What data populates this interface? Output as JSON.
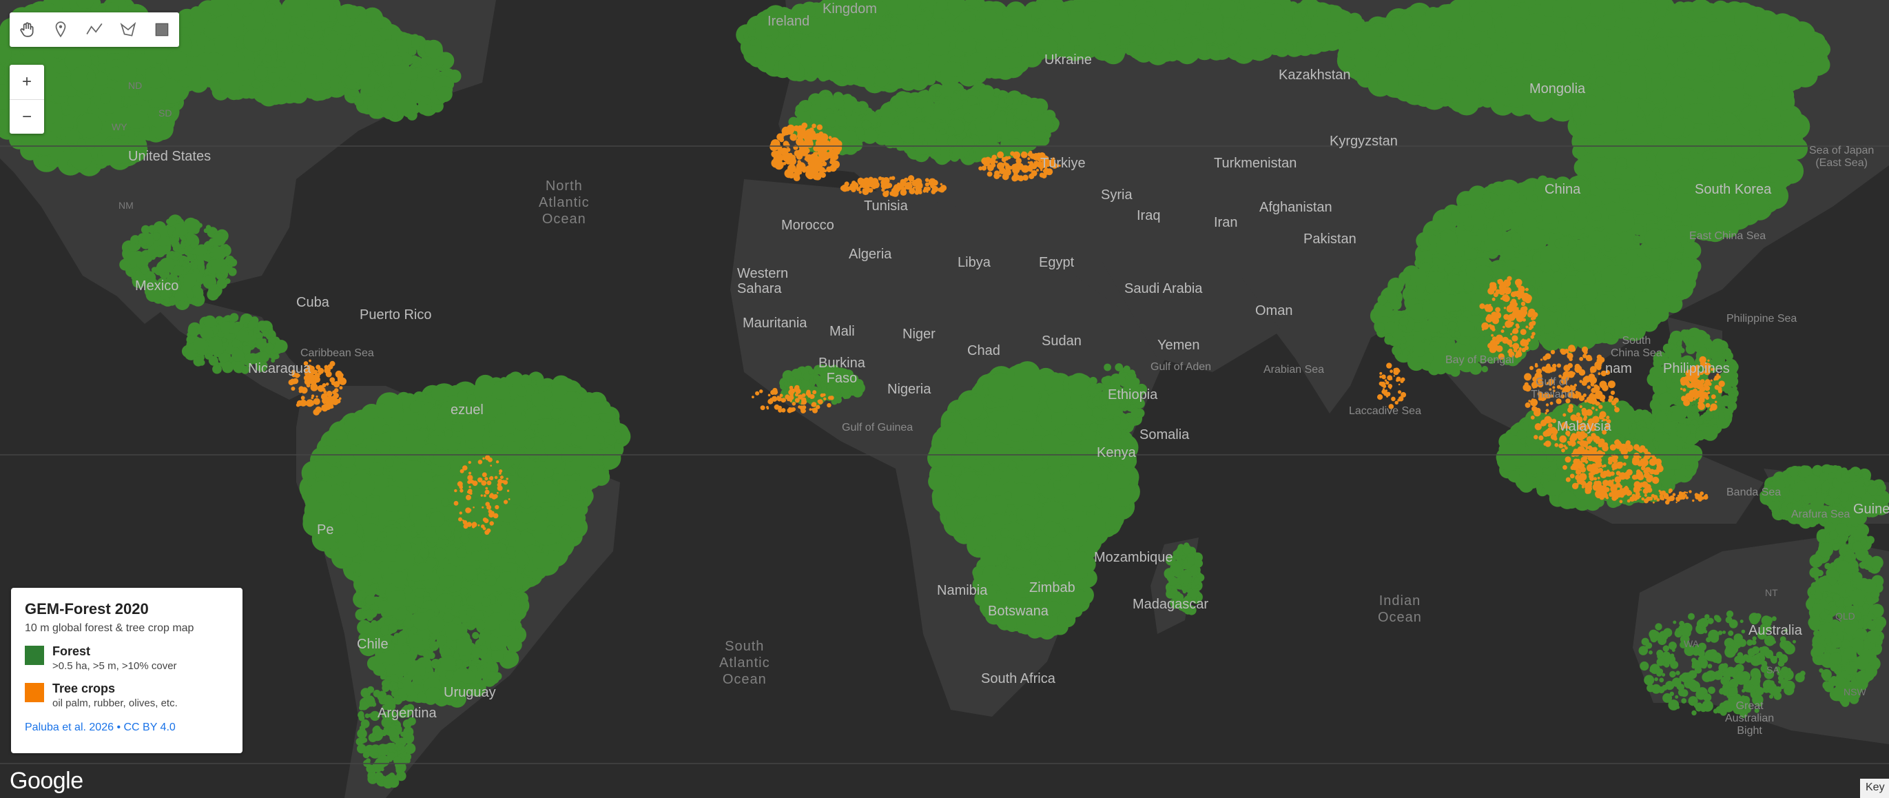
{
  "toolbar": {
    "tools": [
      {
        "name": "hand-pan-icon"
      },
      {
        "name": "marker-pin-icon"
      },
      {
        "name": "polyline-icon"
      },
      {
        "name": "polygon-icon"
      },
      {
        "name": "rectangle-icon"
      }
    ]
  },
  "zoom": {
    "in": "+",
    "out": "−"
  },
  "legend": {
    "title": "GEM-Forest 2020",
    "subtitle": "10 m global forest & tree crop map",
    "items": [
      {
        "label": "Forest",
        "desc": ">0.5 ha, >5 m, >10% cover",
        "color": "#2e7d32"
      },
      {
        "label": "Tree crops",
        "desc": "oil palm, rubber, olives, etc.",
        "color": "#f57c00"
      }
    ],
    "credit": "Paluba et al. 2026 • CC BY 4.0"
  },
  "branding": {
    "logo": "Google",
    "keyboard": "Key"
  },
  "colors": {
    "forest": "#3f8f2f",
    "treecrops": "#f08c1a",
    "land": "#3a3a3a",
    "water": "#2b2b2b"
  },
  "labels": {
    "ireland": "Ireland",
    "kingdom": "Kingdom",
    "kazakhstan": "Kazakhstan",
    "mongolia": "Mongolia",
    "kyrgyzstan": "Kyrgyzstan",
    "turkmenistan": "Turkmenistan",
    "turkiye": "Türkiye",
    "ukraine": "Ukraine",
    "china": "China",
    "south_korea": "South Korea",
    "afghanistan": "Afghanistan",
    "iran": "Iran",
    "iraq": "Iraq",
    "syria": "Syria",
    "pakistan": "Pakistan",
    "tunisia": "Tunisia",
    "morocco": "Morocco",
    "algeria": "Algeria",
    "libya": "Libya",
    "egypt": "Egypt",
    "saudi_arabia": "Saudi Arabia",
    "oman": "Oman",
    "yemen": "Yemen",
    "western_sahara": "Western\nSahara",
    "mauritania": "Mauritania",
    "mali": "Mali",
    "niger": "Niger",
    "chad": "Chad",
    "sudan": "Sudan",
    "burkina_faso": "Burkina\nFaso",
    "nigeria": "Nigeria",
    "ethiopia": "Ethiopia",
    "somalia": "Somalia",
    "kenya": "Kenya",
    "mozambique": "Mozambique",
    "madagascar": "Madagascar",
    "namibia": "Namibia",
    "botswana": "Botswana",
    "zimbabwe": "Zimbab",
    "south_africa": "South Africa",
    "united_states": "United States",
    "mexico": "Mexico",
    "cuba": "Cuba",
    "puerto_rico": "Puerto Rico",
    "nicaragua": "Nicaragua",
    "venezuela": "ezuel",
    "chile": "Chile",
    "argentina": "Argentina",
    "uruguay": "Uruguay",
    "peru": "Pe",
    "australia": "Australia",
    "malaysia": "Malaysia",
    "philippines": "Philippines",
    "vietnam": "nam",
    "new_guinea": "Guinea",
    "ocean_north_atlantic": "North\nAtlantic\nOcean",
    "ocean_south_atlantic": "South\nAtlantic\nOcean",
    "ocean_indian": "Indian\nOcean",
    "caribbean_sea": "Caribbean Sea",
    "gulf_of_guinea": "Gulf of Guinea",
    "gulf_of_aden": "Gulf of Aden",
    "arabian_sea": "Arabian Sea",
    "bay_of_bengal": "Bay of Bengal",
    "laccadive_sea": "Laccadive Sea",
    "philippine_sea": "Philippine Sea",
    "south_china_sea": "South\nChina Sea",
    "east_china_sea": "East China Sea",
    "sea_of_japan": "Sea of Japan\n(East Sea)",
    "banda_sea": "Banda Sea",
    "arafura_sea": "Arafura Sea",
    "great_australian_bight": "Great\nAustralian\nBight",
    "gulf_of_thailand": "Gulf of\nThailand",
    "wa": "WA",
    "sa": "SA",
    "nt": "NT",
    "qld": "QLD",
    "nsw": "NSW",
    "nd": "ND",
    "sd": "SD",
    "wy": "WY",
    "nm": "NM"
  }
}
